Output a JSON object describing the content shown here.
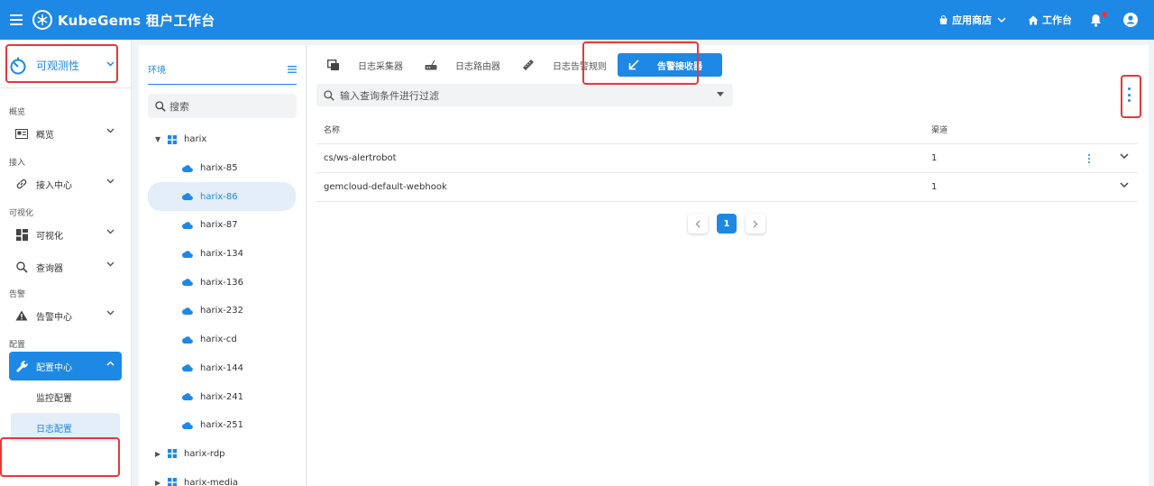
{
  "header": {
    "brand": "KubeGems 租户工作台",
    "app_store": "应用商店",
    "workspace": "工作台",
    "menu_icon": "menu-icon",
    "bell_icon": "bell-icon",
    "account_icon": "account-icon"
  },
  "sidebar": {
    "module": "可观测性",
    "groups": {
      "overview": "概览",
      "access": "接入",
      "visual": "可视化",
      "alert": "告警",
      "config": "配置"
    },
    "items": {
      "overview": "概览",
      "access_center": "接入中心",
      "visualization": "可视化",
      "query": "查询器",
      "alert_center": "告警中心",
      "config_center": "配置中心",
      "monitor_config": "监控配置",
      "log_config": "日志配置"
    }
  },
  "env_panel": {
    "title": "环境",
    "search_placeholder": "搜索",
    "tree": [
      {
        "label": "harix",
        "level": "root",
        "expanded": true
      },
      {
        "label": "harix-85",
        "level": "child"
      },
      {
        "label": "harix-86",
        "level": "child",
        "selected": true
      },
      {
        "label": "harix-87",
        "level": "child"
      },
      {
        "label": "harix-134",
        "level": "child"
      },
      {
        "label": "harix-136",
        "level": "child"
      },
      {
        "label": "harix-232",
        "level": "child"
      },
      {
        "label": "harix-cd",
        "level": "child"
      },
      {
        "label": "harix-144",
        "level": "child"
      },
      {
        "label": "harix-241",
        "level": "child"
      },
      {
        "label": "harix-251",
        "level": "child"
      },
      {
        "label": "harix-rdp",
        "level": "root",
        "expanded": false
      },
      {
        "label": "harix-media",
        "level": "root",
        "expanded": false
      }
    ]
  },
  "main": {
    "tabs": [
      {
        "label": "日志采集器",
        "icon": "collector-icon"
      },
      {
        "label": "日志路由器",
        "icon": "router-icon"
      },
      {
        "label": "日志告警规则",
        "icon": "ruler-icon"
      },
      {
        "label": "告警接收器",
        "icon": "arrow-down-left-icon",
        "active": true
      }
    ],
    "filter_placeholder": "输入查询条件进行过滤",
    "table": {
      "columns": [
        "名称",
        "渠道"
      ],
      "rows": [
        {
          "name": "cs/ws-alertrobot",
          "channels": "1"
        },
        {
          "name": "gemcloud-default-webhook",
          "channels": "1"
        }
      ]
    },
    "pagination": {
      "current": "1"
    }
  },
  "colors": {
    "primary": "#1e88e5",
    "highlight": "#e53935"
  }
}
